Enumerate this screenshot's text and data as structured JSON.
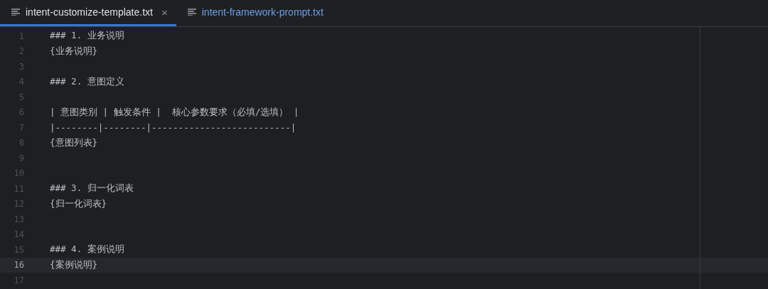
{
  "tabs": [
    {
      "label": "intent-customize-template.txt",
      "selected": true,
      "closable": true
    },
    {
      "label": "intent-framework-prompt.txt",
      "selected": false,
      "closable": false
    }
  ],
  "close_glyph": "×",
  "editor": {
    "lines": [
      {
        "number": "1",
        "text": "### 1. 业务说明",
        "current": false
      },
      {
        "number": "2",
        "text": "{业务说明}",
        "current": false
      },
      {
        "number": "3",
        "current": false
      },
      {
        "number": "4",
        "text": "### 2. 意图定义",
        "current": false
      },
      {
        "number": "5",
        "current": false
      },
      {
        "number": "6",
        "text": "| 意图类别 | 触发条件 |  核心参数要求（必填/选填） |",
        "current": false
      },
      {
        "number": "7",
        "text": "|--------|--------|--------------------------|",
        "current": false
      },
      {
        "number": "8",
        "text": "{意图列表}",
        "current": false
      },
      {
        "number": "9",
        "current": false
      },
      {
        "number": "10",
        "current": false
      },
      {
        "number": "11",
        "text": "### 3. 归一化词表",
        "current": false
      },
      {
        "number": "12",
        "text": "{归一化词表}",
        "current": false
      },
      {
        "number": "13",
        "current": false
      },
      {
        "number": "14",
        "current": false
      },
      {
        "number": "15",
        "text": "### 4. 案例说明",
        "current": false
      },
      {
        "number": "16",
        "text": "{案例说明}",
        "current": true
      },
      {
        "number": "17",
        "current": false
      }
    ]
  }
}
